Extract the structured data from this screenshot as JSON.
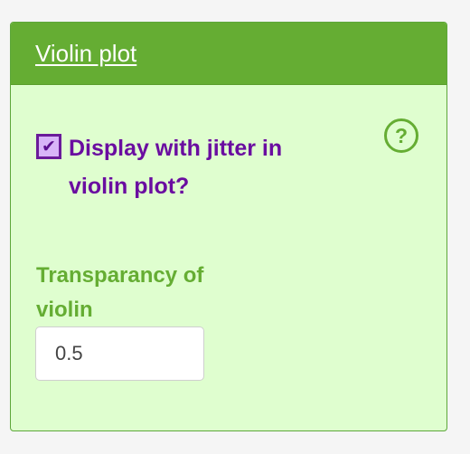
{
  "panel": {
    "title": "Violin plot",
    "checkbox": {
      "label": "Display with jitter in violin plot?",
      "checked": true,
      "check_glyph": "✔"
    },
    "help_icon": {
      "glyph": "?",
      "icon_name": "help-circle-icon"
    },
    "transparency": {
      "label": "Transparancy of violin",
      "value": "0.5"
    }
  },
  "colors": {
    "header_green": "#65ad33",
    "body_green": "#dffecf",
    "accent_purple": "#6a0da0"
  }
}
